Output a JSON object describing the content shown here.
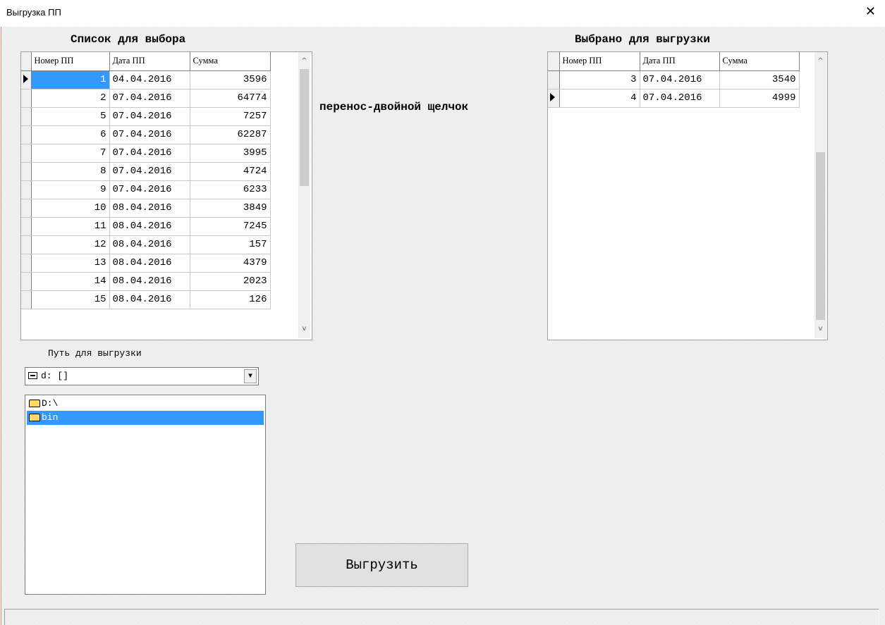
{
  "window": {
    "title": "Выгрузка ПП",
    "close_glyph": "✕"
  },
  "left_list": {
    "title": "Список для выбора",
    "columns": [
      "Номер ПП",
      "Дата ПП",
      "Сумма"
    ],
    "rows": [
      {
        "num": "1",
        "date": "04.04.2016",
        "sum": "3596"
      },
      {
        "num": "2",
        "date": "07.04.2016",
        "sum": "64774"
      },
      {
        "num": "5",
        "date": "07.04.2016",
        "sum": "7257"
      },
      {
        "num": "6",
        "date": "07.04.2016",
        "sum": "62287"
      },
      {
        "num": "7",
        "date": "07.04.2016",
        "sum": "3995"
      },
      {
        "num": "8",
        "date": "07.04.2016",
        "sum": "4724"
      },
      {
        "num": "9",
        "date": "07.04.2016",
        "sum": "6233"
      },
      {
        "num": "10",
        "date": "08.04.2016",
        "sum": "3849"
      },
      {
        "num": "11",
        "date": "08.04.2016",
        "sum": "7245"
      },
      {
        "num": "12",
        "date": "08.04.2016",
        "sum": "157"
      },
      {
        "num": "13",
        "date": "08.04.2016",
        "sum": "4379"
      },
      {
        "num": "14",
        "date": "08.04.2016",
        "sum": "2023"
      },
      {
        "num": "15",
        "date": "08.04.2016",
        "sum": "126"
      }
    ],
    "selected_row": 0
  },
  "right_list": {
    "title": "Выбрано для выгрузки",
    "columns": [
      "Номер ПП",
      "Дата ПП",
      "Сумма"
    ],
    "rows": [
      {
        "num": "3",
        "date": "07.04.2016",
        "sum": "3540"
      },
      {
        "num": "4",
        "date": "07.04.2016",
        "sum": "4999"
      }
    ],
    "current_row": 1
  },
  "hint": "перенос-двойной щелчок",
  "path": {
    "label": "Путь для выгрузки",
    "drive_value": "d: []",
    "folders": [
      {
        "name": "D:\\",
        "selected": false
      },
      {
        "name": "bin",
        "selected": true
      }
    ]
  },
  "export_button": "Выгрузить",
  "colors": {
    "selection": "#3399ff",
    "background": "#f0f0f0"
  }
}
